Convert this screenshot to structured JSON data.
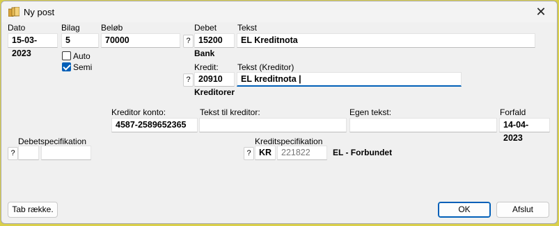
{
  "window": {
    "title": "Ny post",
    "close_glyph": "✕",
    "title_icon": "ledger-icon"
  },
  "labels": {
    "dato": "Dato",
    "bilag": "Bilag",
    "beloeb": "Beløb",
    "debet": "Debet",
    "tekst": "Tekst",
    "kredit": "Kredit:",
    "tekst_kreditor": "Tekst (Kreditor)",
    "kreditor_konto": "Kreditor konto:",
    "tekst_til_kreditor": "Tekst til kreditor:",
    "egen_tekst": "Egen tekst:",
    "forfald": "Forfald",
    "debetspecifikation": "Debetspecifikation",
    "kreditspecifikation": "Kreditspecifikation"
  },
  "fields": {
    "dato": "15-03-2023",
    "bilag": "5",
    "beloeb": "70000",
    "debet_konto": "15200",
    "tekst": "EL Kreditnota",
    "kredit_konto": "20910",
    "tekst_kreditor": "EL kreditnota |",
    "kreditor_konto": "4587-2589652365",
    "tekst_til_kreditor": "",
    "egen_tekst": "",
    "forfald": "14-04-2023",
    "debet_spec_code": "",
    "debet_spec_value": "",
    "kredit_spec_code": "KR",
    "kredit_spec_value": "221822"
  },
  "account_names": {
    "debet": "Bank",
    "kredit": "Kreditorer",
    "kredit_spec": "EL - Forbundet"
  },
  "checkboxes": {
    "auto": {
      "label": "Auto",
      "checked": false
    },
    "semi": {
      "label": "Semi",
      "checked": true
    }
  },
  "help_glyph": "?",
  "buttons": {
    "tab_raekke": "Tab række.",
    "ok": "OK",
    "afslut": "Afslut"
  },
  "colors": {
    "accent": "#005fb8",
    "background": "#f0f0f0",
    "outer": "#d9cf4a"
  }
}
